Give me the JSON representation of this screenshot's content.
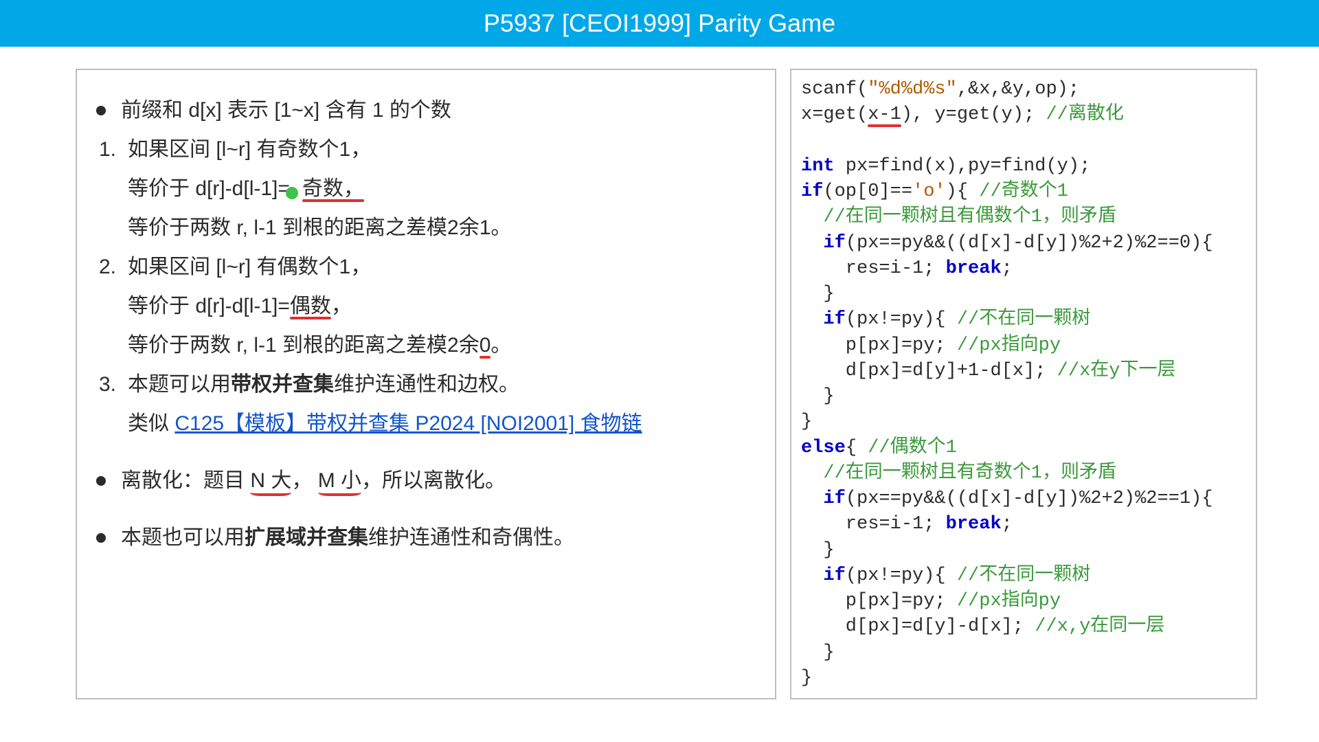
{
  "header": {
    "title": "P5937 [CEOI1999] Parity Game"
  },
  "left": {
    "b1": "前缀和 d[x] 表示 [1~x]  含有 1 的个数",
    "n1_a": "如果区间 [l~r] 有奇数个1，",
    "n1_b_pre": "等价于 d[r]-d[l-1]=",
    "n1_b_ul": "奇数，",
    "n1_c": "等价于两数 r, l-1 到根的距离之差模2余1。",
    "n2_a": "如果区间 [l~r] 有偶数个1，",
    "n2_b_pre": "等价于 d[r]-d[l-1]=",
    "n2_b_ul": "偶数",
    "n2_b_post": "，",
    "n2_c_pre": "等价于两数 r, l-1 到根的距离之差模2余",
    "n2_c_ul": "0",
    "n2_c_post": "。",
    "n3_a_pre": "本题可以用",
    "n3_a_bold": "带权并查集",
    "n3_a_post": "维护连通性和边权。",
    "n3_b_pre": "类似 ",
    "n3_b_link": "C125【模板】带权并查集 P2024 [NOI2001] 食物链",
    "b2_pre": "离散化：题目 ",
    "b2_ul1": "N 大",
    "b2_mid": "， ",
    "b2_ul2": "M 小",
    "b2_post": "，所以离散化。",
    "b3_pre": "本题也可以用",
    "b3_bold": "扩展域并查集",
    "b3_post": "维护连通性和奇偶性。"
  },
  "code": {
    "l01_a": "scanf(",
    "l01_str": "\"%d%d%s\"",
    "l01_b": ",&x,&y,op);",
    "l02_a": "x=get(",
    "l02_ul": "x-1",
    "l02_b": "), y=get(y); ",
    "l02_cmt": "//离散化",
    "l04_kw": "int",
    "l04_b": " px=find(x),py=find(y);",
    "l05_kw": "if",
    "l05_a": "(op[0]==",
    "l05_str": "'o'",
    "l05_b": "){ ",
    "l05_cmt": "//奇数个1",
    "l06_cmt": "  //在同一颗树且有偶数个1，则矛盾",
    "l07_kw": "  if",
    "l07_a": "(px==py&&((d[x]-d[y])%2+2)%2==0){",
    "l08_a": "    res=i-1; ",
    "l08_kw": "break",
    "l08_b": ";",
    "l09": "  }",
    "l10_kw": "  if",
    "l10_a": "(px!=py){ ",
    "l10_cmt": "//不在同一颗树",
    "l11_a": "    p[px]=py; ",
    "l11_cmt": "//px指向py",
    "l12_a": "    d[px]=d[y]+1-d[x]; ",
    "l12_cmt": "//x在y下一层",
    "l13": "  }",
    "l14": "}",
    "l15_kw": "else",
    "l15_a": "{ ",
    "l15_cmt": "//偶数个1",
    "l16_cmt": "  //在同一颗树且有奇数个1，则矛盾",
    "l17_kw": "  if",
    "l17_a": "(px==py&&((d[x]-d[y])%2+2)%2==1){",
    "l18_a": "    res=i-1; ",
    "l18_kw": "break",
    "l18_b": ";",
    "l19": "  }",
    "l20_kw": "  if",
    "l20_a": "(px!=py){ ",
    "l20_cmt": "//不在同一颗树",
    "l21_a": "    p[px]=py; ",
    "l21_cmt": "//px指向py",
    "l22_a": "    d[px]=d[y]-d[x]; ",
    "l22_cmt": "//x,y在同一层",
    "l23": "  }",
    "l24": "}"
  }
}
